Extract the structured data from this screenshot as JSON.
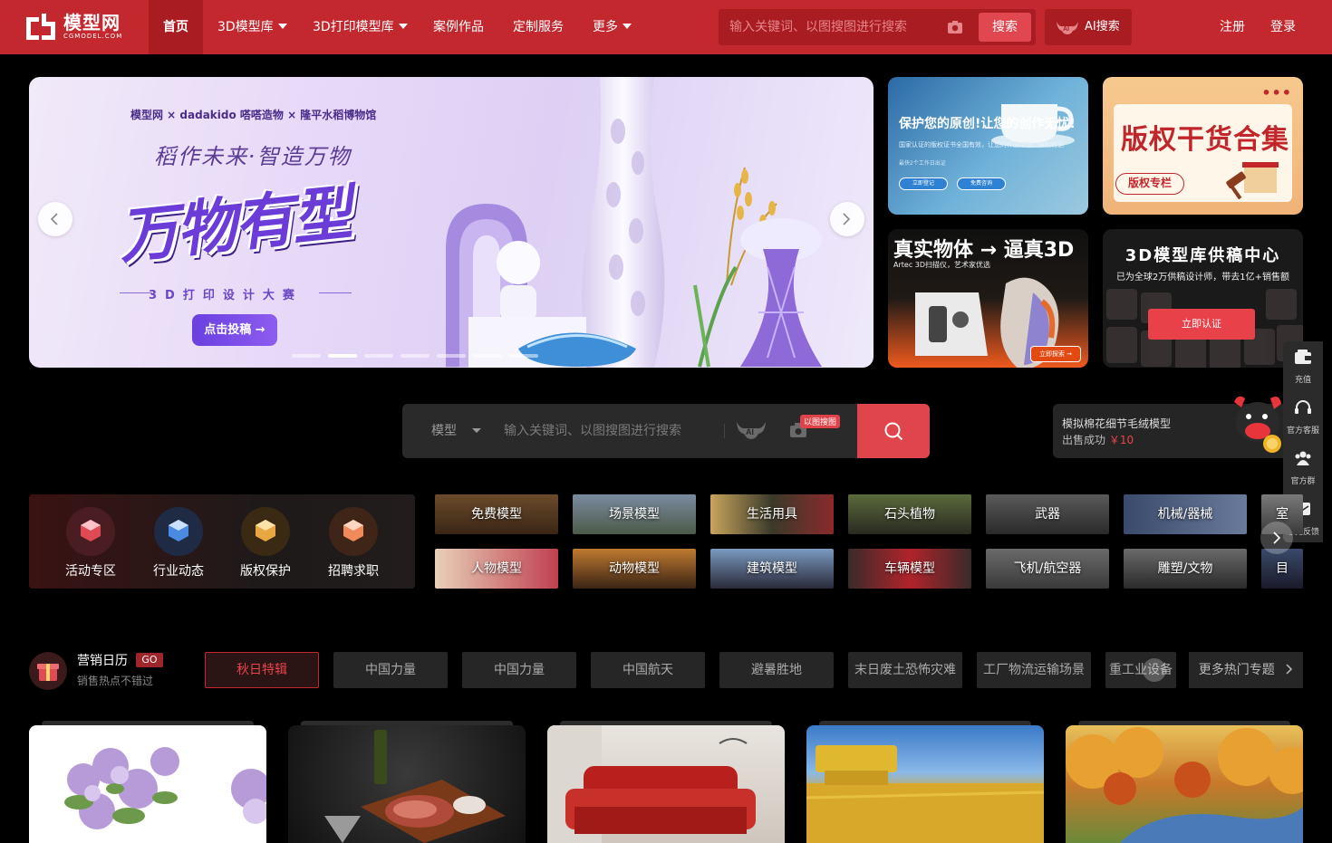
{
  "topbar": {
    "logo": {
      "cn": "模型网",
      "en": "CGMODEL.COM"
    },
    "nav": [
      {
        "label": "首页",
        "active": true,
        "dropdown": false
      },
      {
        "label": "3D模型库",
        "active": false,
        "dropdown": true
      },
      {
        "label": "3D打印模型库",
        "active": false,
        "dropdown": true
      },
      {
        "label": "案例作品",
        "active": false,
        "dropdown": false
      },
      {
        "label": "定制服务",
        "active": false,
        "dropdown": false
      },
      {
        "label": "更多",
        "active": false,
        "dropdown": true
      }
    ],
    "search_placeholder": "输入关键词、以图搜图进行搜索",
    "search_button": "搜索",
    "ai_search": "AI搜索",
    "register": "注册",
    "login": "登录",
    "colors": {
      "bar": "#c3282f",
      "active": "#a81c22"
    }
  },
  "banner": {
    "partners": "模型网 × dadakido 嗒嗒造物 × 隆平水稻博物馆",
    "slogan": "稻作未来·智造万物",
    "big_title": "万物有型",
    "competition": "3D打印设计大赛",
    "cta": "点击投稿 →",
    "active_slide": 2,
    "slide_count": 7
  },
  "tiles": {
    "t1": {
      "title": "保护您的原创!让您的创作无忧!",
      "sub": "国家认证的版权证书全国有效，让您的作品增值、维权有据",
      "sub2": "最快2个工作日出证",
      "btn1": "立即登记",
      "btn2": "免费咨询"
    },
    "t2": {
      "title": "版权干货合集",
      "tag": "版权专栏"
    },
    "t3": {
      "title": "真实物体 → 逼真3D",
      "sub": "Artec 3D扫描仪，艺术家优选",
      "cta": "立即探索 →"
    },
    "t4": {
      "title": "3D模型库供稿中心",
      "sub": "已为全球2万供稿设计师，带去1亿+销售额",
      "btn": "立即认证"
    }
  },
  "mid_search": {
    "type_select": "模型",
    "placeholder": "输入关键词、以图搜图进行搜索",
    "image_search_badge": "以图搜图"
  },
  "sold_ticker": {
    "item": "模拟棉花细节毛绒模型",
    "status": "出售成功",
    "price": "￥10"
  },
  "float_bar": [
    {
      "label": "充值",
      "icon": "wallet-icon"
    },
    {
      "label": "官方客服",
      "icon": "headset-icon"
    },
    {
      "label": "官方群",
      "icon": "group-icon"
    },
    {
      "label": "意见反馈",
      "icon": "mail-icon"
    }
  ],
  "quick_links": [
    {
      "label": "活动专区",
      "color": "#e04a55"
    },
    {
      "label": "行业动态",
      "color": "#4a8ae0"
    },
    {
      "label": "版权保护",
      "color": "#e8a740"
    },
    {
      "label": "招聘求职",
      "color": "#f08a5a"
    }
  ],
  "categories_row1": [
    "免费模型",
    "场景模型",
    "生活用具",
    "石头植物",
    "武器",
    "机械/器械",
    "室"
  ],
  "categories_row2": [
    "人物模型",
    "动物模型",
    "建筑模型",
    "车辆模型",
    "飞机/航空器",
    "雕塑/文物",
    "目"
  ],
  "marketing": {
    "title": "营销日历",
    "go": "GO",
    "subtitle": "销售热点不错过",
    "topics": [
      "秋日特辑",
      "中国力量",
      "中国力量",
      "中国航天",
      "避暑胜地",
      "末日废土恐怖灾难",
      "工厂物流运输场景",
      "重工业设备"
    ],
    "more": "更多热门专题"
  }
}
